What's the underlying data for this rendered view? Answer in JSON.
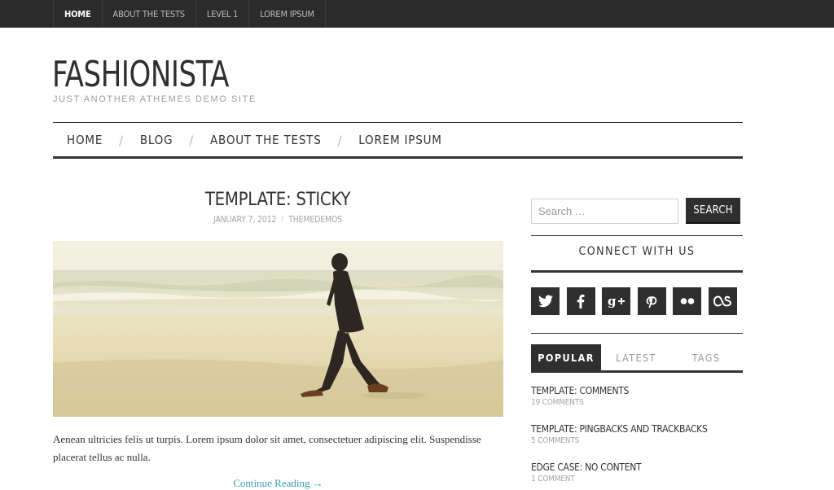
{
  "top_nav": {
    "items": [
      {
        "label": "HOME",
        "active": true
      },
      {
        "label": "ABOUT THE TESTS",
        "active": false
      },
      {
        "label": "LEVEL 1",
        "active": false
      },
      {
        "label": "LOREM IPSUM",
        "active": false
      }
    ]
  },
  "site": {
    "title": "FASHIONISTA",
    "description": "JUST ANOTHER ATHEMES DEMO SITE"
  },
  "main_nav": {
    "items": [
      "HOME",
      "BLOG",
      "ABOUT THE TESTS",
      "LOREM IPSUM"
    ],
    "separator": "/"
  },
  "post": {
    "title": "TEMPLATE: STICKY",
    "date": "JANUARY 7, 2012",
    "meta_separator": "/",
    "author": "THEMEDEMOS",
    "image_icon": "beach-walker-photo",
    "excerpt": "Aenean ultricies felis ut turpis. Lorem ipsum dolor sit amet, consectetuer adipiscing elit. Suspendisse placerat tellus ac nulla.",
    "continue_label": "Continue Reading →"
  },
  "sidebar": {
    "search": {
      "placeholder": "Search …",
      "value": "",
      "button_label": "SEARCH"
    },
    "connect_title": "CONNECT WITH US",
    "social_icons": [
      "twitter-icon",
      "facebook-icon",
      "google-plus-icon",
      "pinterest-icon",
      "flickr-icon",
      "lastfm-icon"
    ],
    "tabs": [
      {
        "label": "POPULAR",
        "active": true
      },
      {
        "label": "LATEST",
        "active": false
      },
      {
        "label": "TAGS",
        "active": false
      }
    ],
    "popular_posts": [
      {
        "title": "TEMPLATE: COMMENTS",
        "comments": "19 COMMENTS"
      },
      {
        "title": "TEMPLATE: PINGBACKS AND TRACKBACKS",
        "comments": "5 COMMENTS"
      },
      {
        "title": "EDGE CASE: NO CONTENT",
        "comments": "1 COMMENT"
      }
    ]
  },
  "colors": {
    "dark": "#2f2f2f",
    "topbar": "#2b2b2b",
    "link": "#3a9bb4",
    "muted": "#a5a5a5"
  }
}
